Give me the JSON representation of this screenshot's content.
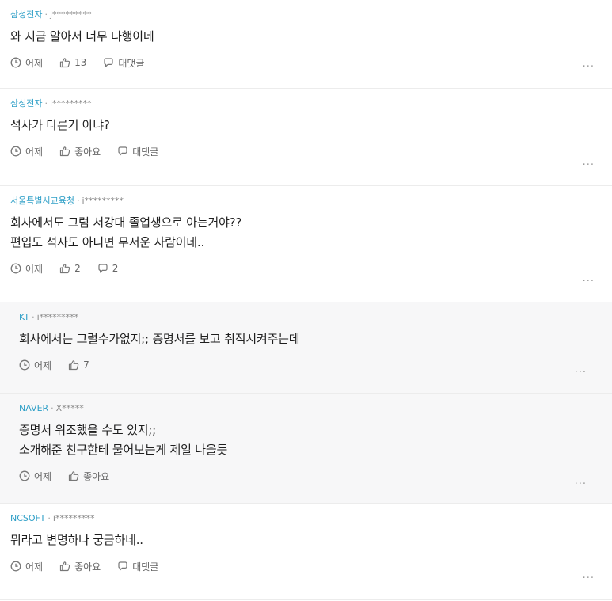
{
  "comments": [
    {
      "company": "삼성전자",
      "user": "j*********",
      "text": [
        "와 지금 알아서 너무 다행이네"
      ],
      "time": "어제",
      "likes": "13",
      "reply": "대댓글",
      "reply_is_count": false
    },
    {
      "company": "삼성전자",
      "user": "l*********",
      "text": [
        "석사가 다른거 아냐?"
      ],
      "time": "어제",
      "likes": "좋아요",
      "reply": "대댓글",
      "reply_is_count": false
    },
    {
      "company": "서울특별시교육청",
      "user": "i*********",
      "text": [
        "회사에서도 그럼 서강대 졸업생으로 아는거야??",
        "편입도 석사도 아니면 무서운 사람이네.."
      ],
      "time": "어제",
      "likes": "2",
      "reply": "2",
      "reply_is_count": true
    },
    {
      "company": "KT",
      "user": "i*********",
      "text": [
        "회사에서는 그럴수가없지;; 증명서를 보고 취직시켜주는데"
      ],
      "time": "어제",
      "likes": "7",
      "reply": null
    },
    {
      "company": "NAVER",
      "user": "X*****",
      "text": [
        "증명서 위조했을 수도 있지;;",
        "소개해준 친구한테 물어보는게 제일 나을듯"
      ],
      "time": "어제",
      "likes": "좋아요",
      "reply": null
    },
    {
      "company": "NCSOFT",
      "user": "i*********",
      "text": [
        "뭐라고 변명하나 궁금하네.."
      ],
      "time": "어제",
      "likes": "좋아요",
      "reply": "대댓글",
      "reply_is_count": false
    }
  ],
  "more_label": "...",
  "colors": {
    "company": "#2e9fc7",
    "reply_bg": "#f7f7f8",
    "divider": "#ececec"
  },
  "icons": {
    "time": "clock-icon",
    "like": "thumbs-up-icon",
    "reply": "speech-bubble-icon",
    "more": "more-icon"
  }
}
